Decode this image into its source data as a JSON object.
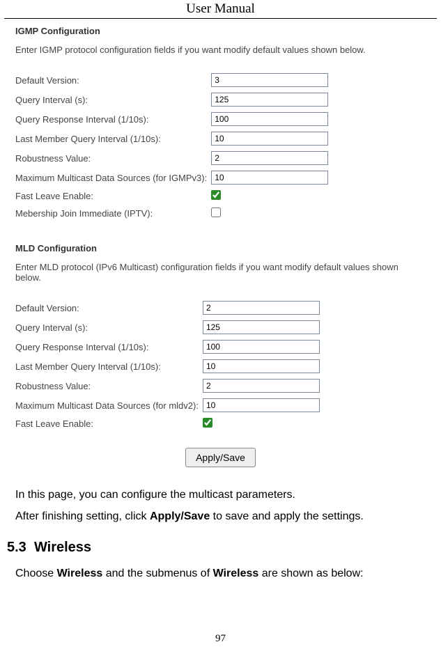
{
  "header": {
    "title": "User Manual"
  },
  "igmp": {
    "title": "IGMP Configuration",
    "desc": "Enter IGMP protocol configuration fields if you want modify default values shown below.",
    "fields": {
      "default_version": {
        "label": "Default Version:",
        "value": "3"
      },
      "query_interval": {
        "label": "Query Interval (s):",
        "value": "125"
      },
      "query_response": {
        "label": "Query Response Interval (1/10s):",
        "value": "100"
      },
      "last_member": {
        "label": "Last Member Query Interval (1/10s):",
        "value": "10"
      },
      "robustness": {
        "label": "Robustness Value:",
        "value": "2"
      },
      "max_sources": {
        "label": "Maximum Multicast Data Sources (for IGMPv3):",
        "value": "10"
      },
      "fast_leave": {
        "label": "Fast Leave Enable:",
        "checked": true
      },
      "membership_join": {
        "label": "Mebership Join Immediate (IPTV):",
        "checked": false
      }
    }
  },
  "mld": {
    "title": "MLD Configuration",
    "desc": "Enter MLD protocol (IPv6 Multicast) configuration fields if you want modify default values shown below.",
    "fields": {
      "default_version": {
        "label": "Default Version:",
        "value": "2"
      },
      "query_interval": {
        "label": "Query Interval (s):",
        "value": "125"
      },
      "query_response": {
        "label": "Query Response Interval (1/10s):",
        "value": "100"
      },
      "last_member": {
        "label": "Last Member Query Interval (1/10s):",
        "value": "10"
      },
      "robustness": {
        "label": "Robustness Value:",
        "value": "2"
      },
      "max_sources": {
        "label": "Maximum Multicast Data Sources (for mldv2):",
        "value": "10"
      },
      "fast_leave": {
        "label": "Fast Leave Enable:",
        "checked": true
      }
    }
  },
  "button": {
    "apply": "Apply/Save"
  },
  "body_text": {
    "p1": "In this page, you can configure the multicast parameters.",
    "p2_a": "After finishing setting, click ",
    "p2_b": "Apply/Save",
    "p2_c": " to save and apply the settings."
  },
  "wireless": {
    "heading_num": "5.3",
    "heading_txt": "Wireless",
    "sentence_a": "Choose ",
    "sentence_b": "Wireless",
    "sentence_c": " and the submenus of ",
    "sentence_d": "Wireless",
    "sentence_e": " are shown as below:"
  },
  "page_number": "97"
}
